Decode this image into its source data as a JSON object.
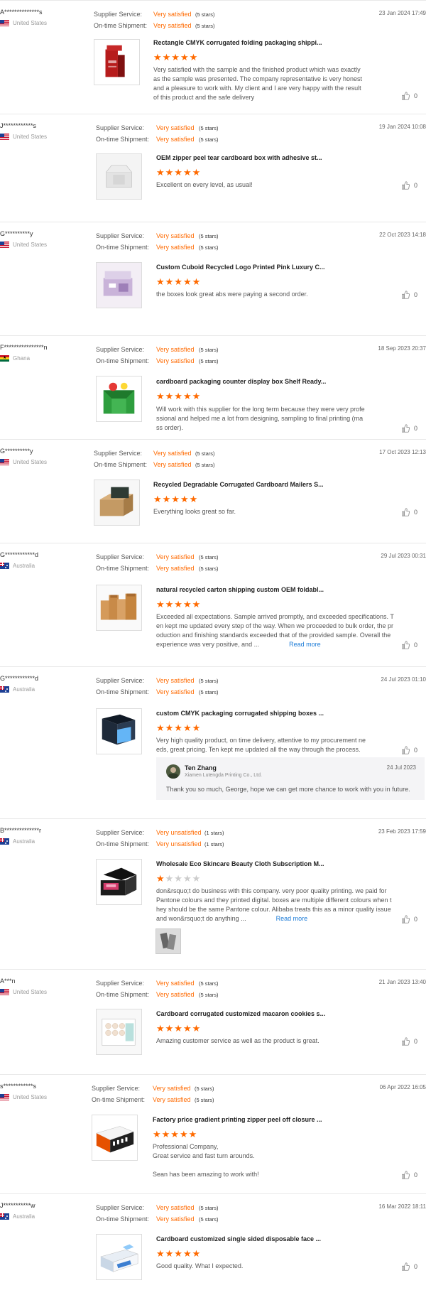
{
  "reviews": [
    {
      "buyer": "A**************s",
      "country": "United States",
      "flag": "us",
      "supplier_service_label": "Supplier Service:",
      "supplier_service_value": "Very satisfied",
      "supplier_service_stars": "(5 stars)",
      "shipment_label": "On-time Shipment:",
      "shipment_value": "Very satisfied",
      "shipment_stars": "(5 stars)",
      "date": "23 Jan 2024 17:49",
      "product_title": "Rectangle CMYK corrugated folding packaging shippi...",
      "rating": 5,
      "rating_stars": "★★★★★",
      "text": "Very satisfied with the sample and the finished product which was exactly\nas the sample was presented. The company representative is very honest\nand a pleasure to work with. My client and I are very happy with the result\nof this product and the safe delivery",
      "likes": "0",
      "product_icon": "red-display-box"
    },
    {
      "buyer": "J************s",
      "country": "United States",
      "flag": "us",
      "supplier_service_label": "Supplier Service:",
      "supplier_service_value": "Very satisfied",
      "supplier_service_stars": "(5 stars)",
      "shipment_label": "On-time Shipment:",
      "shipment_value": "Very satisfied",
      "shipment_stars": "(5 stars)",
      "date": "19 Jan 2024 10:08",
      "product_title": "OEM zipper peel tear cardboard box with adhesive st...",
      "rating": 5,
      "rating_stars": "★★★★★",
      "text": "Excellent on every level, as usual!",
      "likes": "0",
      "product_icon": "white-mailer-box"
    },
    {
      "buyer": "G**********y",
      "country": "United States",
      "flag": "us",
      "supplier_service_label": "Supplier Service:",
      "supplier_service_value": "Very satisfied",
      "supplier_service_stars": "(5 stars)",
      "shipment_label": "On-time Shipment:",
      "shipment_value": "Very satisfied",
      "shipment_stars": "(5 stars)",
      "date": "22 Oct 2023 14:18",
      "product_title": "Custom Cuboid Recycled Logo Printed Pink Luxury C...",
      "rating": 5,
      "rating_stars": "★★★★★",
      "text": "the boxes look great abs were paying a second order.",
      "likes": "0",
      "product_icon": "pink-luxury-box"
    },
    {
      "buyer": "F****************n",
      "country": "Ghana",
      "flag": "gh",
      "supplier_service_label": "Supplier Service:",
      "supplier_service_value": "Very satisfied",
      "supplier_service_stars": "(5 stars)",
      "shipment_label": "On-time Shipment:",
      "shipment_value": "Very satisfied",
      "shipment_stars": "(5 stars)",
      "date": "18 Sep 2023 20:37",
      "product_title": "cardboard packaging counter display box Shelf Ready...",
      "rating": 5,
      "rating_stars": "★★★★★",
      "text": "Will work with this supplier for the long term because they were very profe\nssional and helped me a lot from designing, sampling to final printing (ma\nss order).",
      "likes": "0",
      "product_icon": "green-display-box"
    },
    {
      "buyer": "G**********y",
      "country": "United States",
      "flag": "us",
      "supplier_service_label": "Supplier Service:",
      "supplier_service_value": "Very satisfied",
      "supplier_service_stars": "(5 stars)",
      "shipment_label": "On-time Shipment:",
      "shipment_value": "Very satisfied",
      "shipment_stars": "(5 stars)",
      "date": "17 Oct 2023 12:13",
      "product_title": "Recycled Degradable Corrugated Cardboard Mailers S...",
      "rating": 5,
      "rating_stars": "★★★★★",
      "text": "Everything looks great so far.",
      "likes": "0",
      "product_icon": "kraft-mailer-box"
    },
    {
      "buyer": "G************d",
      "country": "Australia",
      "flag": "au",
      "supplier_service_label": "Supplier Service:",
      "supplier_service_value": "Very satisfied",
      "supplier_service_stars": "(5 stars)",
      "shipment_label": "On-time Shipment:",
      "shipment_value": "Very satisfied",
      "shipment_stars": "(5 stars)",
      "date": "29 Jul 2023 00:31",
      "product_title": "natural recycled carton shipping custom OEM foldabl...",
      "rating": 5,
      "rating_stars": "★★★★★",
      "text": "Exceeded all expectations. Sample arrived promptly, and exceeded specifications. T\nen kept me updated every step of the way. When we proceeded to bulk order, the pr\noduction and finishing standards exceeded that of the provided sample. Overall the\nexperience was very positive, and ...",
      "read_more": "Read more",
      "likes": "0",
      "product_icon": "kraft-cartons"
    },
    {
      "buyer": "G************d",
      "country": "Australia",
      "flag": "au",
      "supplier_service_label": "Supplier Service:",
      "supplier_service_value": "Very satisfied",
      "supplier_service_stars": "(5 stars)",
      "shipment_label": "On-time Shipment:",
      "shipment_value": "Very satisfied",
      "shipment_stars": "(5 stars)",
      "date": "24 Jul 2023 01:10",
      "product_title": "custom CMYK packaging corrugated shipping boxes ...",
      "rating": 5,
      "rating_stars": "★★★★★",
      "text": "Very high quality product, on time delivery, attentive to my procurement ne\neds, great pricing. Ten kept me updated all the way through the process.",
      "likes": "0",
      "product_icon": "black-blue-box",
      "reply": {
        "name": "Ten Zhang",
        "company": "Xiamen Lutengda Printing Co., Ltd.",
        "date": "24 Jul 2023",
        "text": "Thank you so much, George, hope we can get more chance to work with you in future."
      }
    },
    {
      "buyer": "B**************r",
      "country": "Australia",
      "flag": "au",
      "supplier_service_label": "Supplier Service:",
      "supplier_service_value": "Very unsatisfied",
      "supplier_service_stars": "(1 stars)",
      "shipment_label": "On-time Shipment:",
      "shipment_value": "Very unsatisfied",
      "shipment_stars": "(1 stars)",
      "date": "23 Feb 2023 17:59",
      "product_title": "Wholesale Eco Skincare Beauty Cloth Subscription M...",
      "rating": 1,
      "rating_stars_on": "★",
      "rating_stars_off": "★★★★",
      "text": "don&rsquo;t do business with this company. very poor quality printing. we paid for\nPantone colours and they printed digital. boxes are multiple different colours when t\nhey should be the same Pantone colour. Alibaba treats this as a minor quality issue\nand won&rsquo;t do anything ...",
      "read_more": "Read more",
      "likes": "0",
      "product_icon": "black-pink-mailer"
    },
    {
      "buyer": "A***n",
      "country": "United States",
      "flag": "us",
      "supplier_service_label": "Supplier Service:",
      "supplier_service_value": "Very satisfied",
      "supplier_service_stars": "(5 stars)",
      "shipment_label": "On-time Shipment:",
      "shipment_value": "Very satisfied",
      "shipment_stars": "(5 stars)",
      "date": "21 Jan 2023 13:40",
      "product_title": "Cardboard corrugated customized macaron cookies s...",
      "rating": 5,
      "rating_stars": "★★★★★",
      "text": "Amazing customer service as well as the product is great.",
      "likes": "0",
      "product_icon": "macaron-box"
    },
    {
      "buyer": "s************s",
      "country": "United States",
      "flag": "us",
      "supplier_service_label": "Supplier Service:",
      "supplier_service_value": "Very satisfied",
      "supplier_service_stars": "(5 stars)",
      "shipment_label": "On-time Shipment:",
      "shipment_value": "Very satisfied",
      "shipment_stars": "(5 stars)",
      "date": "06 Apr 2022 16:05",
      "product_title": "Factory price gradient printing zipper peel off closure ...",
      "rating": 5,
      "rating_stars": "★★★★★",
      "text": "Professional Company,\nGreat service and fast turn arounds.\n\nSean has been amazing to work with!",
      "likes": "0",
      "product_icon": "orange-mailer-box"
    },
    {
      "buyer": "J***********w",
      "country": "Australia",
      "flag": "au",
      "supplier_service_label": "Supplier Service:",
      "supplier_service_value": "Very satisfied",
      "supplier_service_stars": "(5 stars)",
      "shipment_label": "On-time Shipment:",
      "shipment_value": "Very satisfied",
      "shipment_stars": "(5 stars)",
      "date": "16 Mar 2022 18:11",
      "product_title": "Cardboard customized single sided disposable face ...",
      "rating": 5,
      "rating_stars": "★★★★★",
      "text": "Good quality. What I expected.",
      "likes": "0",
      "product_icon": "blue-face-mask-box"
    }
  ],
  "colors": {
    "accent": "#ff6a00",
    "link": "#1b7bd7",
    "star_off": "#cccccc"
  }
}
